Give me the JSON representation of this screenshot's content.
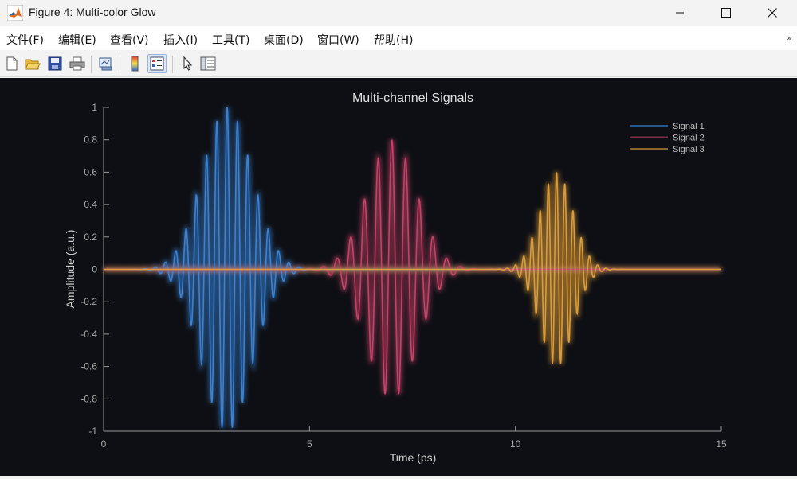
{
  "window": {
    "title": "Figure 4: Multi-color Glow",
    "icon": "matlab-logo-icon"
  },
  "menu": {
    "items": [
      "文件(F)",
      "编辑(E)",
      "查看(V)",
      "插入(I)",
      "工具(T)",
      "桌面(D)",
      "窗口(W)",
      "帮助(H)"
    ],
    "overflow_icon": "chevron-double-right-icon"
  },
  "toolbar": {
    "buttons": [
      "new-figure-icon",
      "open-file-icon",
      "save-icon",
      "print-icon",
      "link-plot-icon",
      "insert-colorbar-icon",
      "insert-legend-icon",
      "edit-plot-arrow-icon",
      "property-inspector-icon"
    ],
    "pressed": "insert-legend-icon"
  },
  "chart_data": {
    "type": "line",
    "title": "Multi-channel Signals",
    "xlabel": "Time (ps)",
    "ylabel": "Amplitude (a.u.)",
    "xlim": [
      0,
      15
    ],
    "ylim": [
      -1,
      1
    ],
    "xticks": [
      "0",
      "5",
      "10",
      "15"
    ],
    "yticks": [
      "1",
      "0.8",
      "0.6",
      "0.4",
      "0.2",
      "0",
      "-0.2",
      "-0.4",
      "-0.6",
      "-0.8",
      "-1"
    ],
    "grid": false,
    "legend_position": "top-right",
    "background": "#0e0f14",
    "series": [
      {
        "name": "Signal 1",
        "color": "#3d85d8",
        "center": 3,
        "peak": 1.0,
        "envelope_width": 0.6,
        "frequency": 4
      },
      {
        "name": "Signal 2",
        "color": "#c9436a",
        "center": 7,
        "peak": 0.8,
        "envelope_width": 0.6,
        "frequency": 3
      },
      {
        "name": "Signal 3",
        "color": "#e0a03a",
        "center": 11,
        "peak": 0.6,
        "envelope_width": 0.4,
        "frequency": 5
      }
    ]
  }
}
